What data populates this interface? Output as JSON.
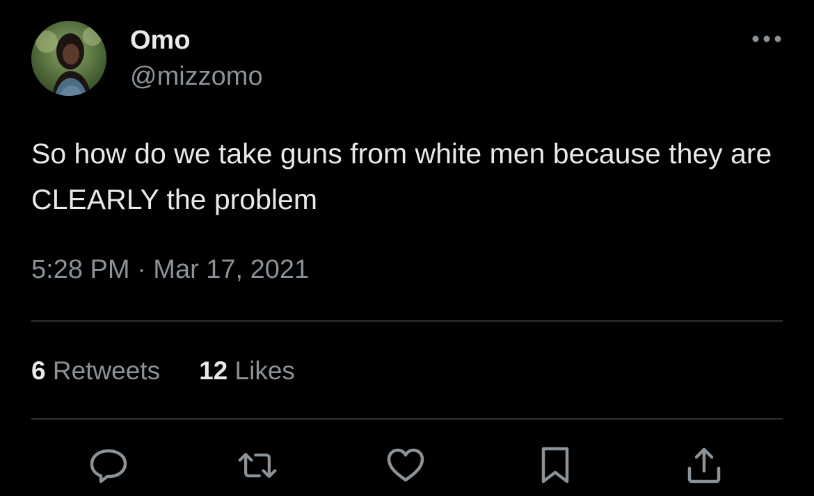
{
  "user": {
    "display_name": "Omo",
    "handle": "@mizzomo",
    "avatar_icon": "profile-photo"
  },
  "tweet": {
    "text": "So how do we take guns from white men because they are CLEARLY the problem",
    "timestamp": "5:28 PM · Mar 17, 2021"
  },
  "stats": {
    "retweets_count": "6",
    "retweets_label": " Retweets",
    "likes_count": "12",
    "likes_label": " Likes"
  },
  "actions": [
    {
      "name": "reply",
      "icon": "speech-bubble-icon"
    },
    {
      "name": "retweet",
      "icon": "retweet-icon"
    },
    {
      "name": "like",
      "icon": "heart-icon"
    },
    {
      "name": "bookmark",
      "icon": "bookmark-icon"
    },
    {
      "name": "share",
      "icon": "share-icon"
    }
  ],
  "colors": {
    "background": "#000000",
    "primary_text": "#e7e9ea",
    "secondary_text": "#8b9298",
    "divider": "#2f3336"
  }
}
